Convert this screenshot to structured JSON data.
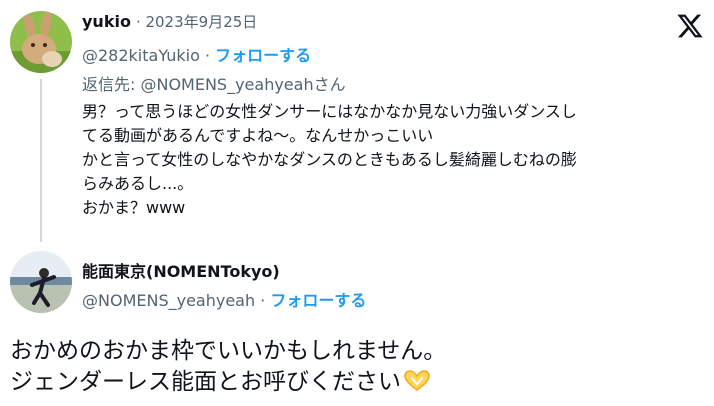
{
  "reply": {
    "author_name": "yukio",
    "date": "· 2023年9月25日",
    "handle": "@282kitaYukio",
    "separator": " · ",
    "follow_label": "フォローする",
    "replying_to": "返信先: @NOMENS_yeahyeahさん",
    "body_lines": [
      "男？って思うほどの女性ダンサーにはなかなか見ない力強いダンスし",
      "てる動画があるんですよね〜。なんせかっこいい",
      "かと言って女性のしなやかなダンスのときもあるし髪綺麗しむねの膨",
      "らみあるし...。",
      "おかま？www"
    ]
  },
  "main": {
    "author_name": "能面東京(NOMENTokyo)",
    "handle": "@NOMENS_yeahyeah",
    "separator": " · ",
    "follow_label": "フォローする",
    "text_lines": [
      "おかめのおかま枠でいいかもしれません。",
      "ジェンダーレス能面とお呼びください"
    ]
  },
  "icons": {
    "brand": "x-logo-icon",
    "emoji": "heart-hands-emoji-icon"
  },
  "colors": {
    "text": "#0f1419",
    "muted": "#536471",
    "link": "#1d9bf0",
    "thread_line": "#cfd9de"
  }
}
